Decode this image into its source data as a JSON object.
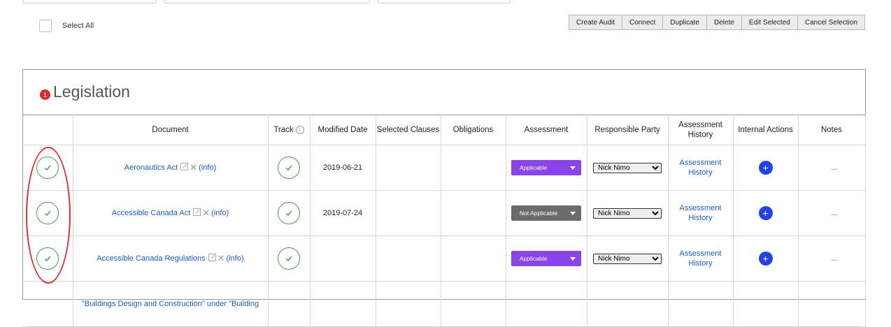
{
  "toolbar": {
    "select_all_label": "Select All",
    "buttons": [
      "Create Audit",
      "Connect",
      "Duplicate",
      "Delete",
      "Edit Selected",
      "Cancel Selection"
    ]
  },
  "section": {
    "badge": "1",
    "title": "Legislation"
  },
  "table": {
    "headers": {
      "document": "Document",
      "track": "Track",
      "modified": "Modified Date",
      "selected_clauses": "Selected Clauses",
      "obligations": "Obligations",
      "assessment": "Assessment",
      "responsible": "Responsible Party",
      "assessment_history": "Assessment History",
      "internal_actions": "Internal Actions",
      "notes": "Notes"
    },
    "info_text": "(info)",
    "history_link": "Assessment History",
    "notes_text": "...",
    "rows": [
      {
        "document": "Aeronautics Act",
        "modified": "2019-06-21",
        "assessment": "Applicable",
        "responsible": "Nick Nimo"
      },
      {
        "document": "Accessible Canada Act",
        "modified": "2019-07-24",
        "assessment": "Not Applicable",
        "responsible": "Nick Nimo"
      },
      {
        "document": "Accessible Canada Regulations",
        "modified": "",
        "assessment": "Applicable",
        "responsible": "Nick Nimo"
      },
      {
        "document": "\"Buildings Design and Construction\" under \"Building",
        "modified": "",
        "assessment": "",
        "responsible": ""
      }
    ]
  },
  "colors": {
    "applicable": "#8a44e8",
    "not_applicable": "#6b6b6b",
    "check_green": "#43a047",
    "link_blue": "#1e5bc6",
    "action_blue": "#2143e6",
    "badge_red": "#d32f2f",
    "annotation_red": "#d33333"
  }
}
